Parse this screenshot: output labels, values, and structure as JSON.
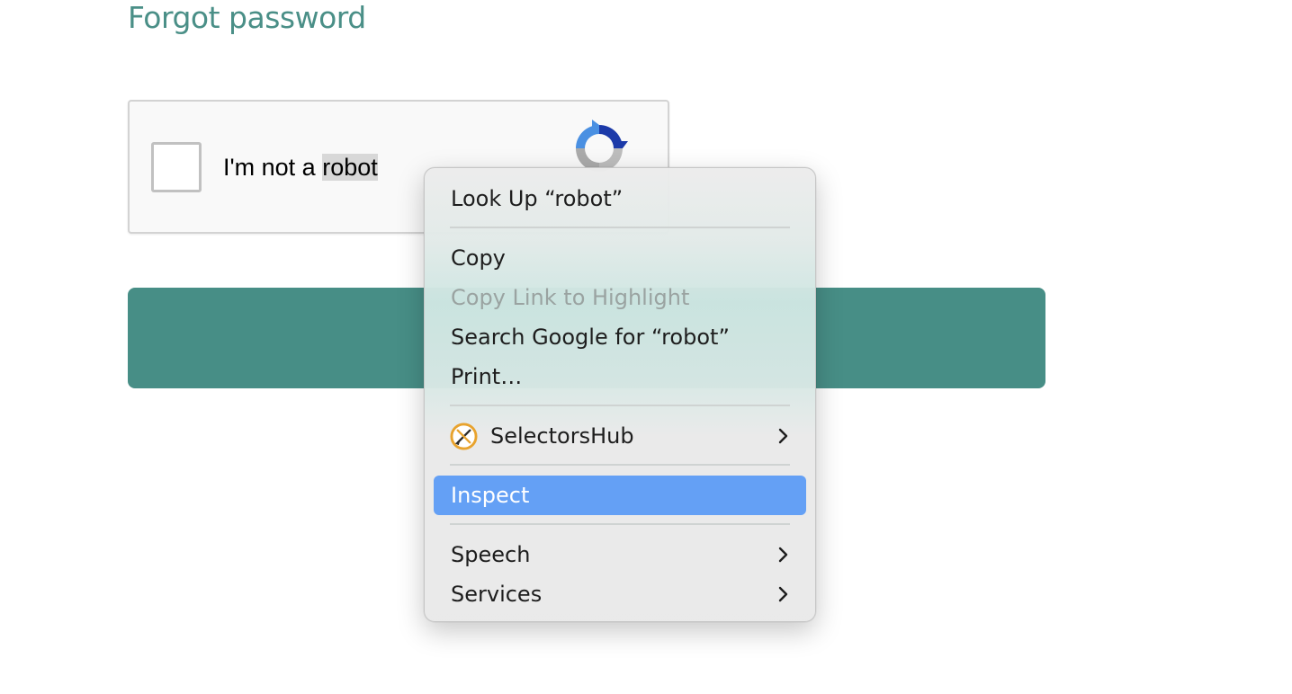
{
  "page": {
    "forgot_password_link": "Forgot password"
  },
  "captcha": {
    "label_prefix": "I'm not a ",
    "label_selected": "robot",
    "logo_icon": "recaptcha-icon"
  },
  "context_menu": {
    "look_up": "Look Up “robot”",
    "copy": "Copy",
    "copy_link_to_highlight": "Copy Link to Highlight",
    "search_google": "Search Google for “robot”",
    "print": "Print…",
    "selectors_hub": "SelectorsHub",
    "inspect": "Inspect",
    "speech": "Speech",
    "services": "Services"
  },
  "colors": {
    "accent_teal": "#478e86",
    "link_teal": "#4a8f87",
    "menu_highlight": "#64a0f5"
  }
}
